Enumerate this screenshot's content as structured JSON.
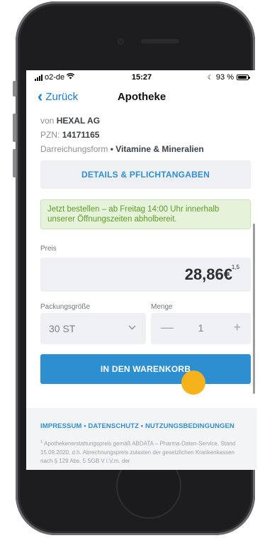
{
  "status_bar": {
    "carrier": "o2-de",
    "time": "15:27",
    "battery": "93 %",
    "battery_level": 0.93
  },
  "nav": {
    "back_label": "Zurück",
    "title": "Apotheke"
  },
  "product": {
    "manufacturer_prefix": "von",
    "manufacturer": "HEXAL AG",
    "pzn_label": "PZN:",
    "pzn": "14171165",
    "form_label": "Darreichungsform",
    "form": "Vitamine & Mineralien"
  },
  "details_button": "DETAILS & PFLICHTANGABEN",
  "notice": "Jetzt bestellen – ab Freitag 14:00 Uhr innerhalb unserer Öffnungszeiten abholbereit.",
  "price": {
    "label": "Preis",
    "value": "28,86€",
    "footnote": "1,5"
  },
  "package": {
    "label": "Packungsgröße",
    "value": "30 ST"
  },
  "quantity": {
    "label": "Menge",
    "value": "1",
    "minus": "—",
    "plus": "+"
  },
  "cart_button": "IN DEN WARENKORB",
  "footer": {
    "links": [
      "IMPRESSUM",
      "DATENSCHUTZ",
      "NUTZUNGSBEDINGUNGEN"
    ],
    "separator": "•",
    "note_marker": "1",
    "note": "Apothekenerstattungspreis gemäß ABDATA – Pharma-Daten-Service, Stand 15.09.2020, d.h. Abrechnungspreis zulasten der gesetzlichen Krankenkassen nach § 129 Abs. 5 SGB V i.V.m. der"
  },
  "colors": {
    "accent": "#2e8fd0",
    "notice_text": "#5d9d2a",
    "notice_bg": "#e6f2d9",
    "tap_indicator": "#f5b21a"
  }
}
